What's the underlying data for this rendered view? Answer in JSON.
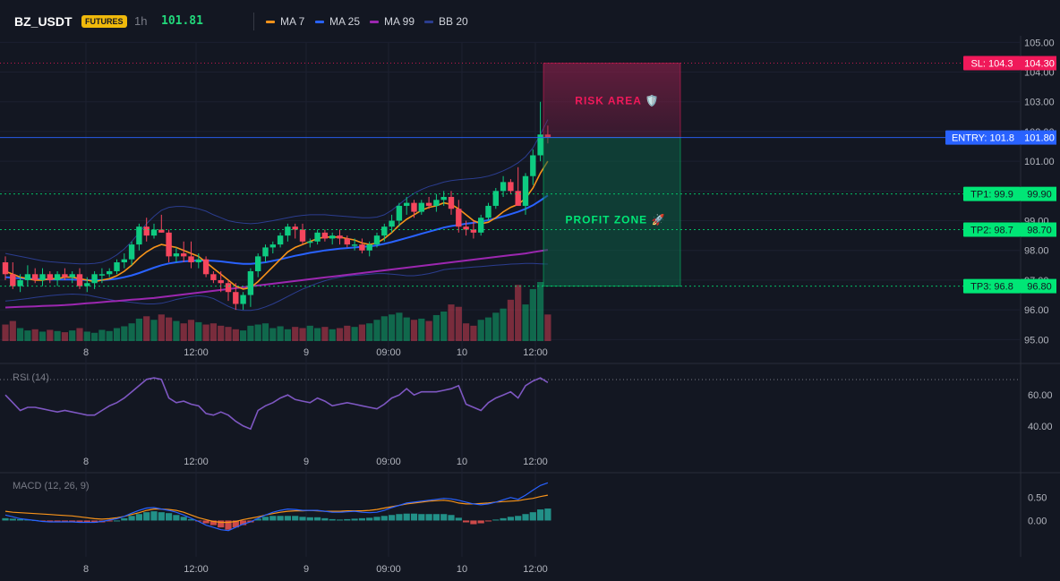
{
  "header": {
    "symbol": "BZ_USDT",
    "badge": "FUTURES",
    "interval": "1h",
    "last_price": "101.81"
  },
  "legend": [
    {
      "label": "MA 7",
      "color": "#f7931a"
    },
    {
      "label": "MA 25",
      "color": "#2962ff"
    },
    {
      "label": "MA 99",
      "color": "#9c27b0"
    },
    {
      "label": "BB 20",
      "color": "#2b3d8f"
    }
  ],
  "colors": {
    "up": "#0ecb81",
    "down": "#f6465d",
    "sl": "#f0195a",
    "entry": "#2962ff",
    "tp": "#00e676",
    "risk_zone": "#7a1f45",
    "profit_zone": "#0d5c46",
    "rsi": "#7e57c2",
    "macd": "#2962ff",
    "signal": "#f7931a"
  },
  "price_axis": {
    "ticks": [
      "95.00",
      "96.00",
      "97.00",
      "98.00",
      "99.00",
      "100.00",
      "101.00",
      "102.00",
      "103.00",
      "104.00",
      "105.00"
    ],
    "ylim": [
      94.95,
      105.1
    ]
  },
  "time_axis": {
    "ticks": [
      "8",
      "12:00",
      "9",
      "09:00",
      "10",
      "12:00"
    ]
  },
  "levels": {
    "sl": {
      "tag": "SL: 104.3",
      "price_label": "104.30",
      "value": 104.3
    },
    "entry": {
      "tag": "ENTRY: 101.8",
      "price_label": "101.80",
      "value": 101.8
    },
    "tp1": {
      "tag": "TP1: 99.9",
      "price_label": "99.90",
      "value": 99.9
    },
    "tp2": {
      "tag": "TP2: 98.7",
      "price_label": "98.70",
      "value": 98.7
    },
    "tp3": {
      "tag": "TP3: 96.8",
      "price_label": "96.80",
      "value": 96.8
    }
  },
  "zones": {
    "risk_label": "RISK AREA 🛡️",
    "profit_label": "PROFIT ZONE 🚀"
  },
  "rsi": {
    "title": "RSI (14)",
    "ticks": [
      "40.00",
      "60.00"
    ],
    "ylim": [
      26,
      78
    ]
  },
  "macd": {
    "title": "MACD (12, 26, 9)",
    "ticks": [
      "0.00",
      "0.50"
    ],
    "ylim": [
      -0.75,
      1.0
    ]
  },
  "chart_data": {
    "type": "candlestick",
    "candles": [
      [
        97.6,
        97.8,
        97.0,
        97.2
      ],
      [
        97.2,
        97.6,
        96.7,
        96.8
      ],
      [
        96.8,
        97.2,
        96.6,
        97.0
      ],
      [
        97.0,
        97.5,
        96.8,
        97.2
      ],
      [
        97.2,
        97.4,
        96.9,
        97.0
      ],
      [
        97.0,
        97.4,
        96.8,
        97.2
      ],
      [
        97.2,
        97.3,
        96.9,
        97.0
      ],
      [
        97.0,
        97.3,
        96.8,
        97.2
      ],
      [
        97.2,
        97.4,
        97.0,
        97.1
      ],
      [
        97.1,
        97.3,
        96.9,
        97.2
      ],
      [
        97.2,
        97.4,
        96.7,
        96.8
      ],
      [
        96.8,
        97.1,
        96.6,
        96.9
      ],
      [
        96.9,
        97.3,
        96.7,
        97.2
      ],
      [
        97.2,
        97.4,
        96.9,
        97.2
      ],
      [
        97.2,
        97.4,
        97.1,
        97.3
      ],
      [
        97.3,
        97.7,
        97.2,
        97.6
      ],
      [
        97.6,
        97.9,
        97.4,
        97.7
      ],
      [
        97.7,
        98.3,
        97.5,
        98.2
      ],
      [
        98.2,
        98.9,
        98.0,
        98.8
      ],
      [
        98.8,
        99.1,
        98.3,
        98.5
      ],
      [
        98.5,
        98.9,
        98.4,
        98.7
      ],
      [
        98.7,
        99.2,
        98.6,
        98.6
      ],
      [
        98.6,
        98.7,
        97.6,
        97.8
      ],
      [
        97.8,
        98.1,
        97.6,
        97.9
      ],
      [
        97.9,
        98.3,
        97.6,
        97.8
      ],
      [
        97.8,
        98.3,
        97.4,
        97.6
      ],
      [
        97.6,
        97.9,
        97.4,
        97.7
      ],
      [
        97.7,
        97.8,
        97.1,
        97.2
      ],
      [
        97.2,
        97.3,
        96.9,
        97.0
      ],
      [
        97.0,
        97.3,
        96.6,
        96.9
      ],
      [
        96.9,
        97.0,
        96.3,
        96.6
      ],
      [
        96.6,
        96.9,
        96.0,
        96.2
      ],
      [
        96.2,
        96.6,
        96.0,
        96.5
      ],
      [
        96.5,
        97.4,
        96.1,
        97.3
      ],
      [
        97.3,
        97.9,
        97.1,
        97.8
      ],
      [
        97.8,
        98.2,
        97.6,
        98.1
      ],
      [
        98.1,
        98.3,
        97.9,
        98.2
      ],
      [
        98.2,
        98.6,
        98.1,
        98.5
      ],
      [
        98.5,
        98.9,
        98.3,
        98.8
      ],
      [
        98.8,
        98.9,
        98.4,
        98.7
      ],
      [
        98.7,
        98.9,
        98.2,
        98.3
      ],
      [
        98.3,
        98.4,
        98.1,
        98.3
      ],
      [
        98.3,
        98.7,
        98.2,
        98.6
      ],
      [
        98.6,
        98.7,
        98.3,
        98.4
      ],
      [
        98.4,
        98.6,
        98.2,
        98.5
      ],
      [
        98.5,
        98.7,
        98.2,
        98.4
      ],
      [
        98.4,
        98.5,
        98.1,
        98.2
      ],
      [
        98.2,
        98.4,
        98.0,
        98.2
      ],
      [
        98.2,
        98.4,
        97.9,
        98.0
      ],
      [
        98.0,
        98.3,
        97.8,
        98.2
      ],
      [
        98.2,
        98.6,
        98.1,
        98.5
      ],
      [
        98.5,
        98.9,
        98.3,
        98.8
      ],
      [
        98.8,
        99.2,
        98.6,
        99.0
      ],
      [
        99.0,
        99.6,
        98.8,
        99.5
      ],
      [
        99.5,
        99.8,
        99.2,
        99.6
      ],
      [
        99.6,
        99.7,
        99.1,
        99.3
      ],
      [
        99.3,
        99.7,
        99.2,
        99.6
      ],
      [
        99.6,
        99.8,
        99.4,
        99.5
      ],
      [
        99.5,
        99.9,
        99.3,
        99.7
      ],
      [
        99.7,
        100.0,
        99.5,
        99.8
      ],
      [
        99.8,
        100.0,
        99.2,
        99.4
      ],
      [
        99.4,
        99.7,
        98.6,
        98.8
      ],
      [
        98.8,
        99.0,
        98.5,
        98.7
      ],
      [
        98.7,
        99.0,
        98.4,
        98.6
      ],
      [
        98.6,
        99.2,
        98.5,
        99.1
      ],
      [
        99.1,
        99.6,
        99.0,
        99.5
      ],
      [
        99.5,
        100.1,
        99.4,
        100.0
      ],
      [
        100.0,
        100.5,
        99.8,
        100.3
      ],
      [
        100.3,
        100.4,
        99.9,
        100.0
      ],
      [
        100.0,
        100.8,
        99.6,
        99.5
      ],
      [
        99.5,
        100.6,
        99.2,
        100.5
      ],
      [
        100.5,
        101.4,
        100.2,
        101.2
      ],
      [
        101.2,
        103.0,
        101.0,
        101.9
      ],
      [
        101.9,
        102.2,
        101.6,
        101.8
      ]
    ],
    "volumes": [
      0.28,
      0.34,
      0.22,
      0.18,
      0.2,
      0.16,
      0.19,
      0.17,
      0.15,
      0.18,
      0.22,
      0.16,
      0.14,
      0.19,
      0.17,
      0.22,
      0.25,
      0.3,
      0.38,
      0.42,
      0.36,
      0.45,
      0.4,
      0.34,
      0.3,
      0.36,
      0.32,
      0.28,
      0.3,
      0.26,
      0.24,
      0.2,
      0.18,
      0.26,
      0.28,
      0.3,
      0.22,
      0.25,
      0.2,
      0.24,
      0.22,
      0.26,
      0.22,
      0.24,
      0.2,
      0.22,
      0.26,
      0.24,
      0.28,
      0.3,
      0.36,
      0.42,
      0.45,
      0.48,
      0.4,
      0.36,
      0.38,
      0.34,
      0.44,
      0.5,
      0.62,
      0.58,
      0.3,
      0.26,
      0.36,
      0.4,
      0.48,
      0.55,
      0.7,
      0.95,
      0.62,
      0.88,
      1.0,
      0.45
    ],
    "ma7": [
      97.3,
      97.2,
      97.1,
      97.05,
      97.0,
      97.0,
      97.05,
      97.05,
      97.1,
      97.1,
      97.05,
      97.0,
      96.95,
      97.0,
      97.05,
      97.15,
      97.3,
      97.5,
      97.75,
      97.95,
      98.1,
      98.2,
      98.15,
      98.1,
      98.0,
      97.9,
      97.8,
      97.6,
      97.4,
      97.2,
      97.0,
      96.8,
      96.7,
      96.75,
      96.95,
      97.2,
      97.45,
      97.7,
      97.95,
      98.1,
      98.2,
      98.3,
      98.4,
      98.45,
      98.45,
      98.45,
      98.4,
      98.35,
      98.25,
      98.2,
      98.25,
      98.4,
      98.6,
      98.85,
      99.05,
      99.2,
      99.35,
      99.45,
      99.5,
      99.6,
      99.55,
      99.4,
      99.2,
      99.0,
      98.9,
      98.95,
      99.1,
      99.3,
      99.45,
      99.55,
      99.75,
      100.1,
      100.6,
      101.0
    ],
    "ma25": [
      97.1,
      97.08,
      97.06,
      97.05,
      97.04,
      97.03,
      97.02,
      97.02,
      97.02,
      97.02,
      97.01,
      97.0,
      97.0,
      97.0,
      97.02,
      97.05,
      97.1,
      97.16,
      97.24,
      97.33,
      97.42,
      97.5,
      97.56,
      97.6,
      97.63,
      97.65,
      97.66,
      97.66,
      97.65,
      97.63,
      97.6,
      97.57,
      97.55,
      97.55,
      97.57,
      97.6,
      97.65,
      97.7,
      97.76,
      97.82,
      97.87,
      97.92,
      97.96,
      98.0,
      98.03,
      98.06,
      98.08,
      98.1,
      98.12,
      98.14,
      98.17,
      98.22,
      98.28,
      98.35,
      98.42,
      98.49,
      98.56,
      98.63,
      98.7,
      98.77,
      98.82,
      98.86,
      98.9,
      98.93,
      98.97,
      99.02,
      99.08,
      99.15,
      99.22,
      99.3,
      99.4,
      99.52,
      99.68,
      99.85
    ],
    "ma99": [
      96.08,
      96.09,
      96.1,
      96.11,
      96.12,
      96.13,
      96.14,
      96.15,
      96.16,
      96.18,
      96.2,
      96.22,
      96.24,
      96.26,
      96.28,
      96.3,
      96.32,
      96.34,
      96.36,
      96.38,
      96.4,
      96.43,
      96.46,
      96.49,
      96.52,
      96.55,
      96.58,
      96.61,
      96.64,
      96.67,
      96.7,
      96.73,
      96.76,
      96.79,
      96.82,
      96.85,
      96.88,
      96.91,
      96.94,
      96.97,
      97.0,
      97.03,
      97.06,
      97.09,
      97.12,
      97.15,
      97.18,
      97.21,
      97.24,
      97.27,
      97.3,
      97.33,
      97.36,
      97.39,
      97.42,
      97.45,
      97.48,
      97.51,
      97.54,
      97.57,
      97.6,
      97.63,
      97.66,
      97.69,
      97.72,
      97.75,
      97.78,
      97.81,
      97.84,
      97.87,
      97.9,
      97.94,
      97.98,
      98.02
    ],
    "bb_upper": [
      97.9,
      97.85,
      97.8,
      97.75,
      97.7,
      97.65,
      97.62,
      97.6,
      97.58,
      97.56,
      97.55,
      97.55,
      97.56,
      97.6,
      97.7,
      97.85,
      98.05,
      98.3,
      98.6,
      98.9,
      99.15,
      99.35,
      99.45,
      99.48,
      99.48,
      99.45,
      99.4,
      99.32,
      99.2,
      99.1,
      99.0,
      98.95,
      98.92,
      98.9,
      98.92,
      98.96,
      99.0,
      99.05,
      99.1,
      99.15,
      99.18,
      99.2,
      99.2,
      99.2,
      99.18,
      99.16,
      99.14,
      99.12,
      99.1,
      99.1,
      99.12,
      99.2,
      99.35,
      99.55,
      99.75,
      99.92,
      100.05,
      100.15,
      100.22,
      100.3,
      100.35,
      100.38,
      100.4,
      100.42,
      100.45,
      100.5,
      100.58,
      100.68,
      100.8,
      100.95,
      101.15,
      101.45,
      101.9,
      102.4
    ],
    "bb_lower": [
      96.3,
      96.32,
      96.35,
      96.38,
      96.42,
      96.45,
      96.48,
      96.5,
      96.52,
      96.53,
      96.52,
      96.5,
      96.45,
      96.4,
      96.35,
      96.3,
      96.28,
      96.25,
      96.22,
      96.2,
      96.2,
      96.22,
      96.28,
      96.35,
      96.4,
      96.45,
      96.48,
      96.45,
      96.38,
      96.25,
      96.12,
      96.02,
      95.98,
      95.98,
      96.02,
      96.1,
      96.2,
      96.32,
      96.45,
      96.58,
      96.7,
      96.8,
      96.9,
      96.98,
      97.05,
      97.1,
      97.14,
      97.16,
      97.18,
      97.2,
      97.22,
      97.22,
      97.2,
      97.18,
      97.15,
      97.15,
      97.18,
      97.22,
      97.28,
      97.35,
      97.38,
      97.4,
      97.42,
      97.44,
      97.46,
      97.48,
      97.5,
      97.52,
      97.54,
      97.55,
      97.56,
      97.56,
      97.55,
      97.54
    ],
    "rsi_values": [
      60,
      55,
      50,
      52,
      52,
      51,
      50,
      49,
      50,
      49,
      48,
      47,
      47,
      50,
      53,
      55,
      58,
      62,
      66,
      70,
      71,
      70,
      58,
      55,
      56,
      54,
      53,
      48,
      47,
      49,
      47,
      43,
      40,
      38,
      50,
      53,
      55,
      58,
      60,
      57,
      56,
      55,
      58,
      56,
      53,
      54,
      55,
      54,
      53,
      52,
      51,
      54,
      58,
      60,
      64,
      60,
      62,
      62,
      62,
      63,
      64,
      66,
      54,
      52,
      50,
      55,
      58,
      60,
      62,
      58,
      66,
      69,
      71,
      68
    ],
    "macd_line": [
      0.12,
      0.08,
      0.04,
      0.02,
      0.0,
      -0.02,
      -0.03,
      -0.03,
      -0.03,
      -0.03,
      -0.04,
      -0.04,
      -0.04,
      -0.02,
      0.01,
      0.04,
      0.09,
      0.16,
      0.22,
      0.27,
      0.28,
      0.25,
      0.22,
      0.18,
      0.12,
      0.05,
      -0.02,
      -0.1,
      -0.15,
      -0.2,
      -0.22,
      -0.15,
      -0.08,
      -0.03,
      0.05,
      0.12,
      0.18,
      0.22,
      0.25,
      0.24,
      0.22,
      0.22,
      0.22,
      0.2,
      0.18,
      0.18,
      0.19,
      0.2,
      0.18,
      0.17,
      0.18,
      0.22,
      0.28,
      0.33,
      0.38,
      0.4,
      0.42,
      0.44,
      0.46,
      0.48,
      0.47,
      0.44,
      0.4,
      0.36,
      0.34,
      0.36,
      0.4,
      0.45,
      0.5,
      0.46,
      0.55,
      0.66,
      0.76,
      0.82
    ],
    "signal_line": [
      0.2,
      0.18,
      0.17,
      0.16,
      0.15,
      0.14,
      0.13,
      0.12,
      0.11,
      0.1,
      0.08,
      0.06,
      0.04,
      0.03,
      0.04,
      0.06,
      0.09,
      0.13,
      0.17,
      0.22,
      0.25,
      0.25,
      0.24,
      0.22,
      0.18,
      0.12,
      0.06,
      0.02,
      -0.02,
      -0.04,
      -0.04,
      -0.02,
      0.02,
      0.05,
      0.08,
      0.12,
      0.15,
      0.18,
      0.2,
      0.21,
      0.21,
      0.22,
      0.21,
      0.2,
      0.2,
      0.2,
      0.21,
      0.21,
      0.21,
      0.22,
      0.24,
      0.27,
      0.3,
      0.33,
      0.36,
      0.38,
      0.4,
      0.42,
      0.43,
      0.44,
      0.42,
      0.38,
      0.36,
      0.36,
      0.37,
      0.38,
      0.4,
      0.41,
      0.42,
      0.43,
      0.46,
      0.48,
      0.52,
      0.55
    ],
    "histogram": [
      0.05,
      0.04,
      0.03,
      0.02,
      0.01,
      -0.01,
      -0.02,
      -0.02,
      -0.02,
      -0.03,
      -0.03,
      -0.04,
      -0.05,
      -0.04,
      -0.02,
      0.0,
      0.05,
      0.1,
      0.14,
      0.18,
      0.2,
      0.18,
      0.16,
      0.12,
      0.08,
      0.03,
      -0.02,
      -0.06,
      -0.1,
      -0.15,
      -0.2,
      -0.15,
      -0.1,
      -0.04,
      0.04,
      0.08,
      0.1,
      0.1,
      0.1,
      0.1,
      0.08,
      0.07,
      0.07,
      0.05,
      0.03,
      0.02,
      0.03,
      0.04,
      0.05,
      0.06,
      0.08,
      0.1,
      0.12,
      0.14,
      0.15,
      0.15,
      0.14,
      0.14,
      0.14,
      0.14,
      0.12,
      0.06,
      -0.04,
      -0.08,
      -0.06,
      -0.02,
      0.02,
      0.05,
      0.08,
      0.1,
      0.14,
      0.18,
      0.24,
      0.26
    ]
  }
}
